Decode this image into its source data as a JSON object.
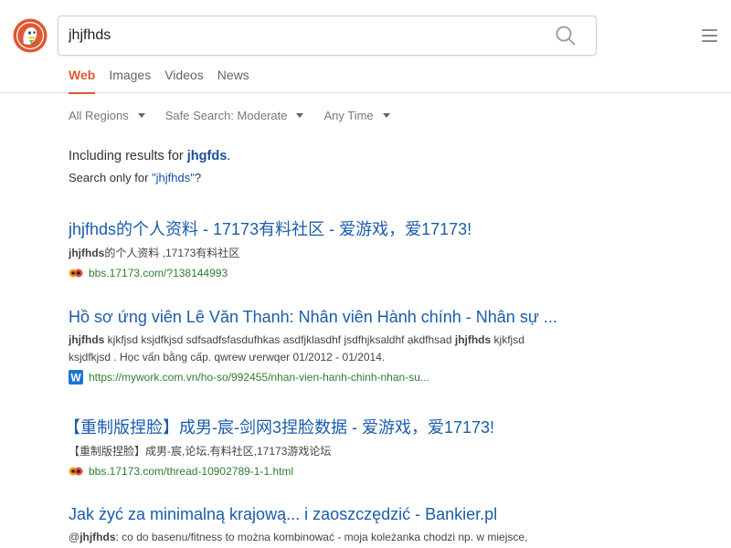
{
  "header": {
    "search_value": "jhjfhds",
    "icons": {
      "logo": "duckduckgo-logo",
      "search": "search-icon",
      "menu": "hamburger-menu-icon"
    }
  },
  "tabs": [
    {
      "label": "Web",
      "active": true
    },
    {
      "label": "Images",
      "active": false
    },
    {
      "label": "Videos",
      "active": false
    },
    {
      "label": "News",
      "active": false
    }
  ],
  "filters": [
    {
      "label": "All Regions"
    },
    {
      "label": "Safe Search: Moderate"
    },
    {
      "label": "Any Time"
    }
  ],
  "correction": {
    "including_prefix": "Including results for ",
    "corrected_term": "jhgfds",
    "including_suffix": ".",
    "only_prefix": "Search only for ",
    "only_term": "\"jhjfhds\"",
    "only_suffix": "?"
  },
  "results": [
    {
      "title": "jhjfhds的个人资料 - 17173有料社区 - 爱游戏，爱17173!",
      "snippet_bold": "jhjfhds",
      "snippet_rest": "的个人资料 ,17173有料社区",
      "url": "bbs.17173.com/?138144993",
      "favicon": "17173-favicon"
    },
    {
      "title": "Hồ sơ ứng viên Lê Văn Thanh: Nhân viên Hành chính - Nhân sự ...",
      "snippet_line1_bold": "jhjfhds",
      "snippet_line1_mid": " kjkfjsd ksjdfkjsd sdfsadfsfasdufhkas asdfjklasdhf jsdfhjksaldhf ạkdfhsad ",
      "snippet_line1_bold2": "jhjfhds",
      "snippet_line1_end": " kjkfjsd",
      "snippet_line2": "ksjdfkjsd . Học vấn bằng cấp. qwrew ưerwqer 01/2012 - 01/2014.",
      "url": "https://mywork.com.vn/ho-so/992455/nhan-vien-hanh-chinh-nhan-su...",
      "favicon": "mywork-w-favicon"
    },
    {
      "title": "【重制版捏脸】成男-宸-剑网3捏脸数据 - 爱游戏，爱17173!",
      "snippet": "【重制版捏脸】成男-宸,论坛,有料社区,17173游戏论坛",
      "url": "bbs.17173.com/thread-10902789-1-1.html",
      "favicon": "17173-favicon"
    },
    {
      "title": "Jak żyć za minimalną krajową... i zaoszczędzić - Bankier.pl",
      "snippet_prefix": "@",
      "snippet_bold": "jhjfhds",
      "snippet_rest": ": co do basenu/fitness to można kombinować - moja koleżanka chodzi np. w miejsce,"
    }
  ],
  "colors": {
    "accent": "#de5833",
    "link": "#1a5dab",
    "url_green": "#2e7d32",
    "w_favicon": "#1976d2"
  }
}
